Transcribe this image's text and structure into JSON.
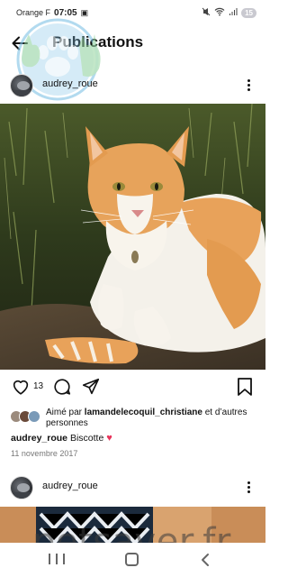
{
  "status_bar": {
    "carrier": "Orange F",
    "time": "07:05",
    "battery": "15",
    "notification_icon": "notification-icon"
  },
  "header": {
    "title": "Publications",
    "back_icon": "arrow-left-icon"
  },
  "post": {
    "username": "audrey_roue",
    "like_count": "13",
    "liked_by_prefix": "Aimé par",
    "liked_by_user": "lamandelecoquil_christiane",
    "liked_by_suffix": "et d’autres personnes",
    "caption_user": "audrey_roue",
    "caption_text": "Biscotte",
    "caption_emoji": "♥",
    "date": "11 novembre 2017"
  },
  "next_post": {
    "username": "audrey_roue"
  },
  "watermark": {
    "text": "petsaver.fr"
  },
  "colors": {
    "heart_emoji": "#e8335a",
    "watermark_logo": "#7fc3e6"
  }
}
